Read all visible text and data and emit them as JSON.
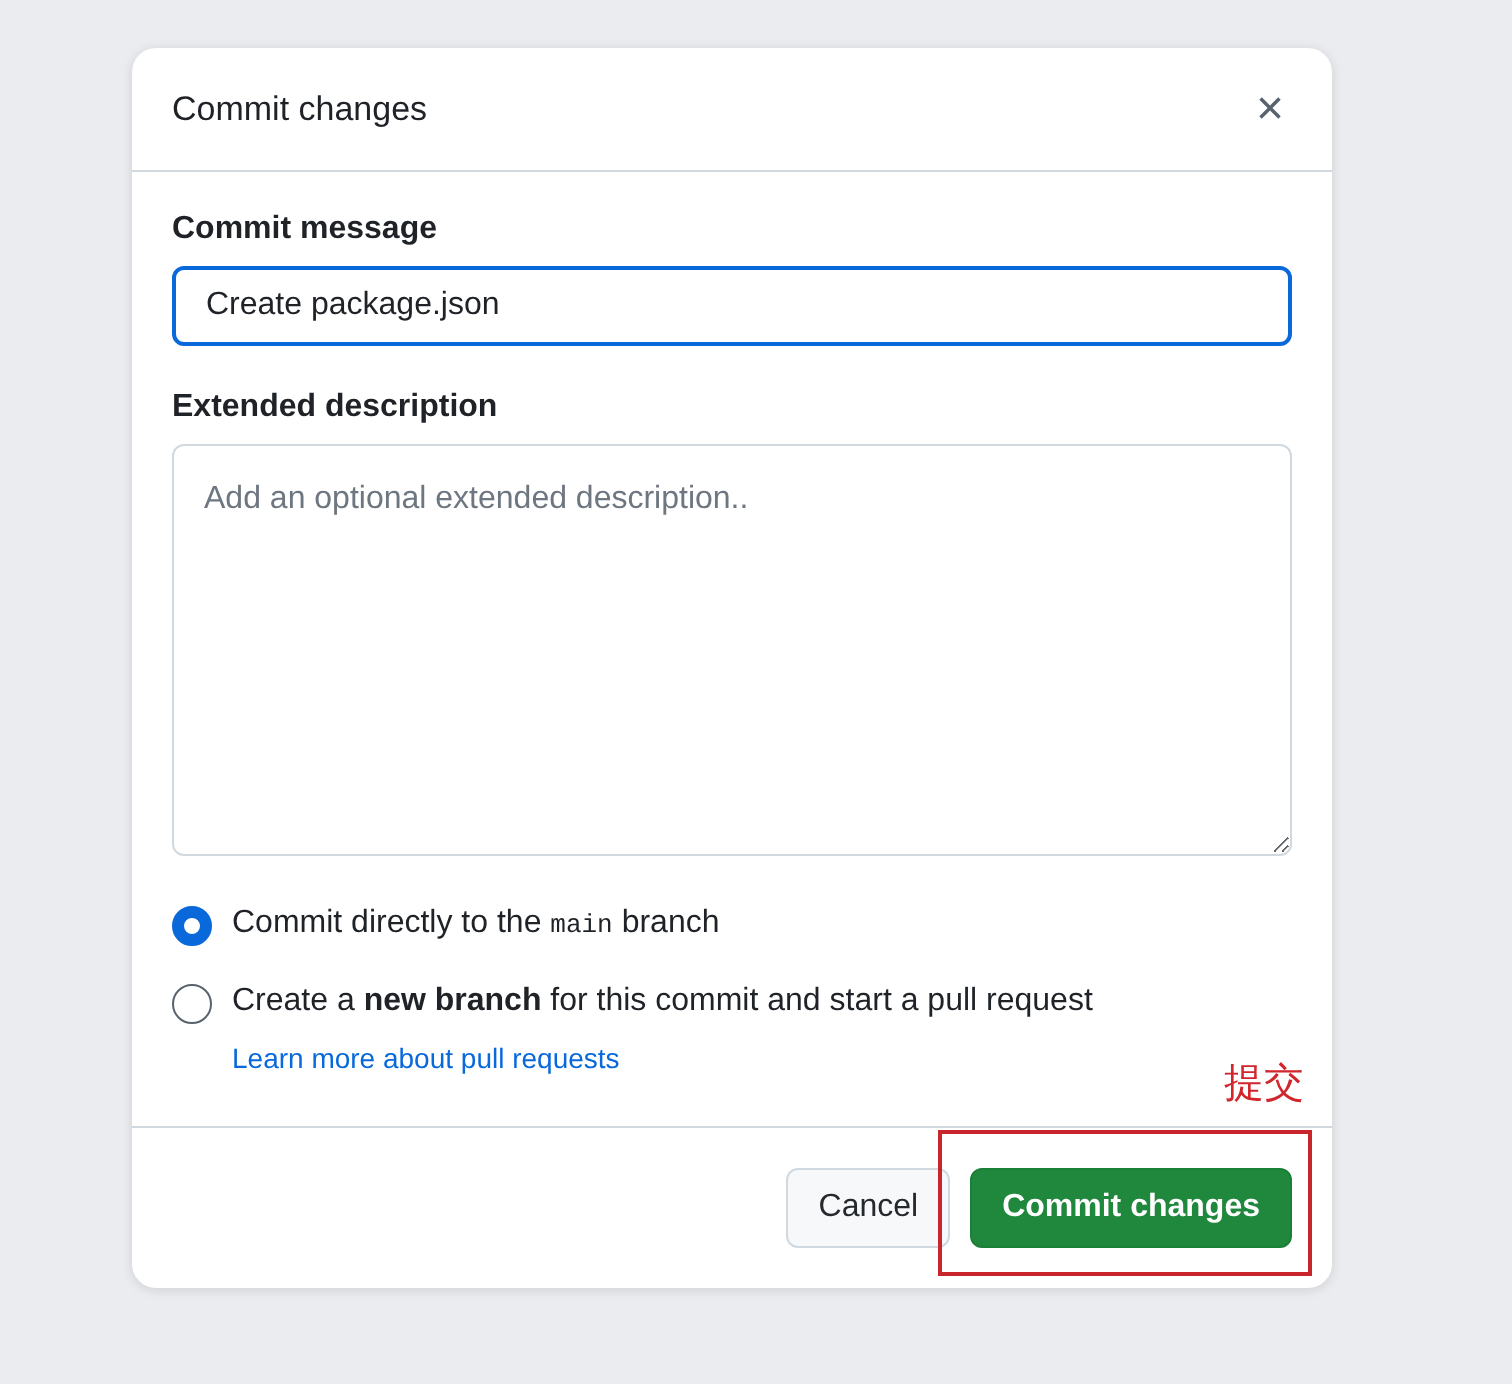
{
  "dialog": {
    "title": "Commit changes",
    "close": "×"
  },
  "commit_message": {
    "label": "Commit message",
    "value": "Create package.json"
  },
  "extended_description": {
    "label": "Extended description",
    "placeholder": "Add an optional extended description.."
  },
  "options": [
    {
      "kind": "direct",
      "selected": true,
      "label": "Commit directly to the",
      "code": "main",
      "label_after": "branch"
    },
    {
      "kind": "new_branch",
      "selected": false,
      "label": "Create a **new branch** for this commit and start a pull request",
      "link": "Learn more about pull requests"
    }
  ],
  "buttons": [
    {
      "kind": "secondary",
      "label": "Cancel"
    },
    {
      "kind": "primary",
      "label": "Commit changes",
      "highlighted": true
    }
  ],
  "annotation": {
    "text": "提交"
  }
}
